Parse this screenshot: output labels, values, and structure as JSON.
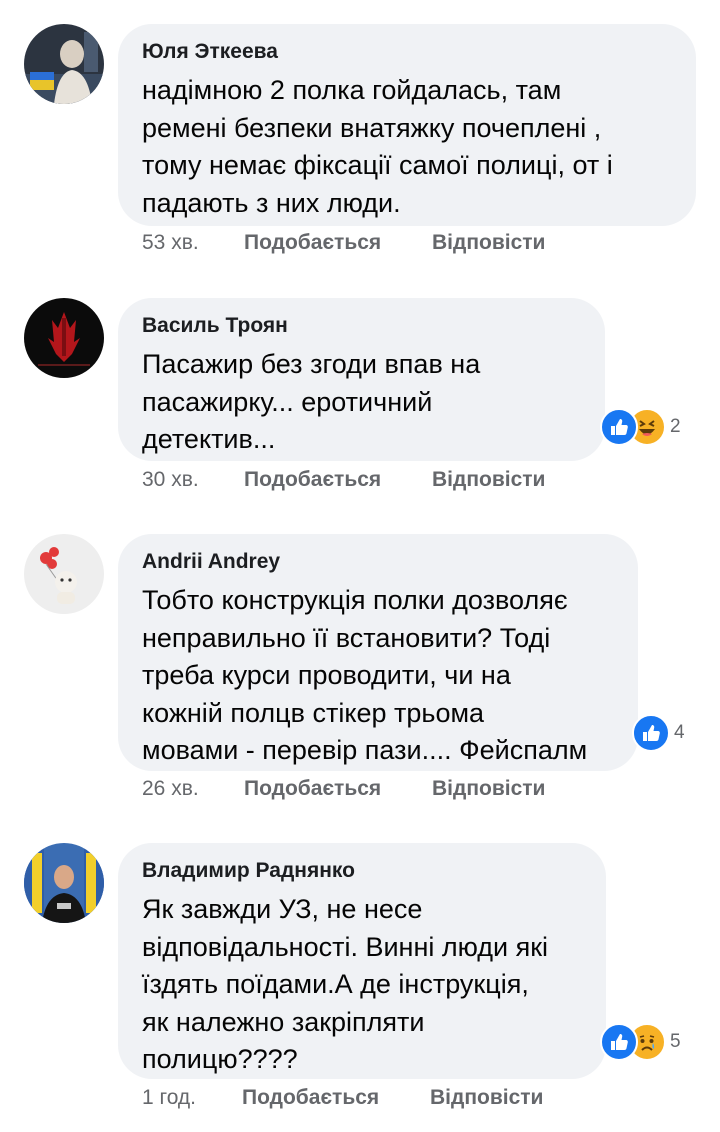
{
  "comments": [
    {
      "author": "Юля Эткеева",
      "text": "надімною 2 полка гойдалась, там\nремені безпеки внатяжку почеплені ,\nтому немає фіксації самої  полиці, от і\nпадають з них люди.",
      "time": "53 хв.",
      "like_label": "Подобається",
      "reply_label": "Відповісти"
    },
    {
      "author": "Василь Троян",
      "text": "Пасажир без згоди впав на\nпасажирку... еротичний\nдетектив...",
      "time": "30 хв.",
      "like_label": "Подобається",
      "reply_label": "Відповісти",
      "reactions": [
        "like",
        "haha"
      ],
      "reaction_count": "2"
    },
    {
      "author": "Andrii Andrey",
      "text": "Тобто конструкція полки дозволяє\nнеправильно її встановити?  Тоді\nтреба курси проводити,  чи на\nкожній полцв стікер трьома\nмовами - перевір пази.... Фейспалм",
      "time": "26 хв.",
      "like_label": "Подобається",
      "reply_label": "Відповісти",
      "reactions": [
        "like"
      ],
      "reaction_count": "4"
    },
    {
      "author": "Владимир Раднянко",
      "text": "Як завжди УЗ, не несе\nвідповідальності. Винні люди які\nїздять поїдами.А де інструкція,\nяк належно закріпляти\nполицю????",
      "time": "1 год.",
      "like_label": "Подобається",
      "reply_label": "Відповісти",
      "reactions": [
        "like",
        "sad"
      ],
      "reaction_count": "5"
    }
  ],
  "colors": {
    "bubble": "#f0f2f5",
    "meta": "#65676b",
    "like": "#1877f2",
    "emoji": "#f7b125"
  }
}
